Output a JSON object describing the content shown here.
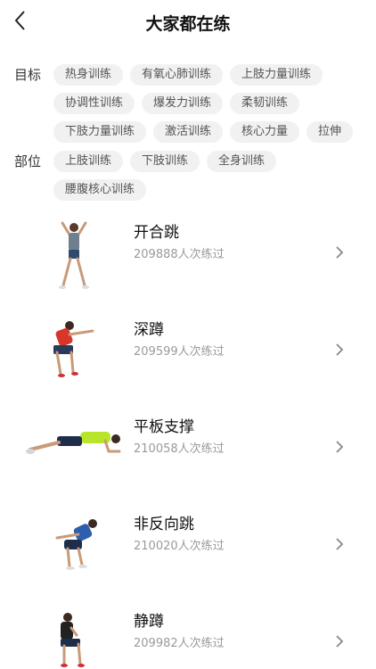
{
  "header": {
    "title": "大家都在练"
  },
  "filters": {
    "goal_label": "目标",
    "goal_tags": [
      "热身训练",
      "有氧心肺训练",
      "上肢力量训练",
      "协调性训练",
      "爆发力训练",
      "柔韧训练",
      "下肢力量训练",
      "激活训练",
      "核心力量",
      "拉伸"
    ],
    "part_label": "部位",
    "part_tags": [
      "上肢训练",
      "下肢训练",
      "全身训练",
      "腰腹核心训练"
    ]
  },
  "exercises": [
    {
      "name": "开合跳",
      "count": "209888人次练过"
    },
    {
      "name": "深蹲",
      "count": "209599人次练过"
    },
    {
      "name": "平板支撑",
      "count": "210058人次练过"
    },
    {
      "name": "非反向跳",
      "count": "210020人次练过"
    },
    {
      "name": "静蹲",
      "count": "209982人次练过"
    }
  ],
  "colors": {
    "chip_bg": "#f1f1f1",
    "count_text": "#9a9a9a",
    "shirt_gray": "#6e7f8e",
    "shirt_red": "#d9362b",
    "shirt_lime": "#b8e52a",
    "shirt_blue": "#2d5fae",
    "shirt_black": "#222222"
  }
}
